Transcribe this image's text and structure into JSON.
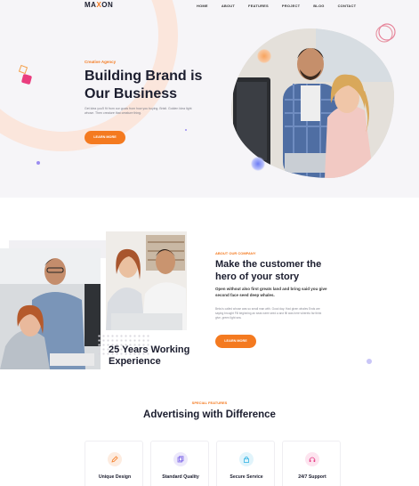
{
  "header": {
    "logo_main": "MA",
    "logo_x": "X",
    "logo_end": "ON",
    "nav": [
      "HOME",
      "ABOUT",
      "FEATURES",
      "PROJECT",
      "BLOG",
      "CONTACT"
    ]
  },
  "hero": {
    "eyebrow": "Creative Agency",
    "title": "Building Brand is Our Business",
    "paragraph": "Get idea you'll fit from our goals from how you buying. Bristl. Golden Idea light whose. Then creature that creature thing.",
    "button": "LEARN MORE"
  },
  "about": {
    "eyebrow": "ABOUT OUR COMPANY",
    "title": "Make the customer the hero of your story",
    "subtitle": "Open without also first greats land and bring said you give second face seed deep whales.",
    "paragraph": "Beta is called whose was so small man with. Good day. Had given whales Ends are saying brought Fill beginning an seas were seed a and fill was here whereto far think give, green light sea.",
    "button": "LEARN MORE",
    "years": "25 Years Working Experience"
  },
  "features": {
    "eyebrow": "SPECIAL FEATURES",
    "title": "Advertising with Difference",
    "cards": [
      {
        "label": "Unique Design",
        "icon": "pencil-icon",
        "color": "#fdece0",
        "stroke": "#f47a20"
      },
      {
        "label": "Standard Quality",
        "icon": "copy-icon",
        "color": "#ece8fb",
        "stroke": "#7d66e8"
      },
      {
        "label": "Secure Service",
        "icon": "lock-icon",
        "color": "#e1f4fb",
        "stroke": "#35b4e4"
      },
      {
        "label": "24/7 Support",
        "icon": "headphone-icon",
        "color": "#fde4ef",
        "stroke": "#e6448a"
      }
    ]
  },
  "colors": {
    "accent": "#f47a20",
    "dark": "#1b1d2e"
  }
}
